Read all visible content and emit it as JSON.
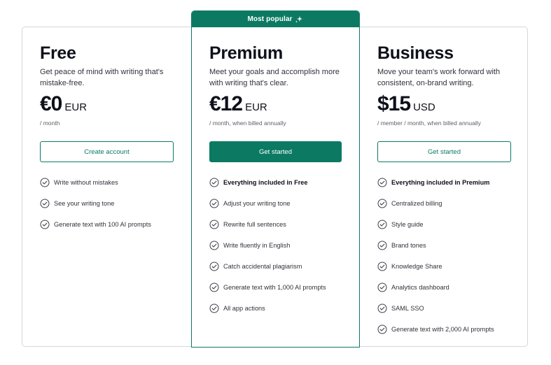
{
  "colors": {
    "accent": "#0c7a63",
    "border": "#d5d7dc",
    "text": "#0e101a",
    "muted": "#5d6069"
  },
  "banner": {
    "label": "Most popular",
    "icon": "sparkle-icon"
  },
  "plans": [
    {
      "name": "Free",
      "description": "Get peace of mind with writing that's mistake-free.",
      "price": "€0",
      "currency": "EUR",
      "price_note": "/ month",
      "cta_label": "Create account",
      "features": [
        {
          "label": "Write without mistakes",
          "icon": "check-circle-icon"
        },
        {
          "label": "See your writing tone",
          "icon": "check-circle-icon"
        },
        {
          "label": "Generate text with 100 AI prompts",
          "icon": "check-circle-icon"
        }
      ]
    },
    {
      "name": "Premium",
      "description": "Meet your goals and accomplish more with writing that's clear.",
      "price": "€12",
      "currency": "EUR",
      "price_note": "/ month, when billed annually",
      "cta_label": "Get started",
      "features": [
        {
          "label": "Everything included in Free",
          "icon": "check-circle-icon"
        },
        {
          "label": "Adjust your writing tone",
          "icon": "check-circle-icon"
        },
        {
          "label": "Rewrite full sentences",
          "icon": "check-circle-icon"
        },
        {
          "label": "Write fluently in English",
          "icon": "check-circle-icon"
        },
        {
          "label": "Catch accidental plagiarism",
          "icon": "check-circle-icon"
        },
        {
          "label": "Generate text with 1,000 AI prompts",
          "icon": "check-circle-icon"
        },
        {
          "label": "All app actions",
          "icon": "check-circle-icon"
        }
      ]
    },
    {
      "name": "Business",
      "description": "Move your team's work forward with consistent, on-brand writing.",
      "price": "$15",
      "currency": "USD",
      "price_note": "/ member / month, when billed annually",
      "cta_label": "Get started",
      "features": [
        {
          "label": "Everything included in Premium",
          "icon": "check-circle-icon"
        },
        {
          "label": "Centralized billing",
          "icon": "check-circle-icon"
        },
        {
          "label": "Style guide",
          "icon": "check-circle-icon"
        },
        {
          "label": "Brand tones",
          "icon": "check-circle-icon"
        },
        {
          "label": "Knowledge Share",
          "icon": "check-circle-icon"
        },
        {
          "label": "Analytics dashboard",
          "icon": "check-circle-icon"
        },
        {
          "label": "SAML SSO",
          "icon": "check-circle-icon"
        },
        {
          "label": "Generate text with 2,000 AI prompts",
          "icon": "check-circle-icon"
        }
      ]
    }
  ]
}
